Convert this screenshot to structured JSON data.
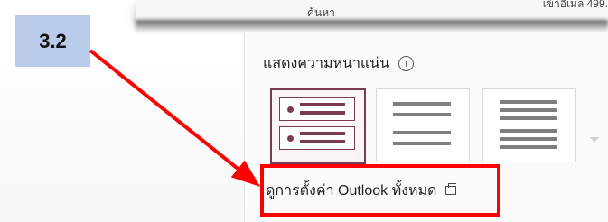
{
  "top": {
    "search_label": "ค้นหา",
    "clipped_text": "เข้าอีเมล 499."
  },
  "badge": {
    "text": "3.2"
  },
  "panel": {
    "density_title": "แสดงความหนาแน่น",
    "info_icon_glyph": "i",
    "view_all_settings": "ดูการตั้งค่า Outlook ทั้งหมด"
  },
  "density_options": [
    {
      "name": "full",
      "selected": true
    },
    {
      "name": "medium",
      "selected": false
    },
    {
      "name": "compact",
      "selected": false
    }
  ],
  "colors": {
    "annotation": "#ff0000",
    "accent": "#7a3b52",
    "badge_bg": "#b9cbe8"
  }
}
